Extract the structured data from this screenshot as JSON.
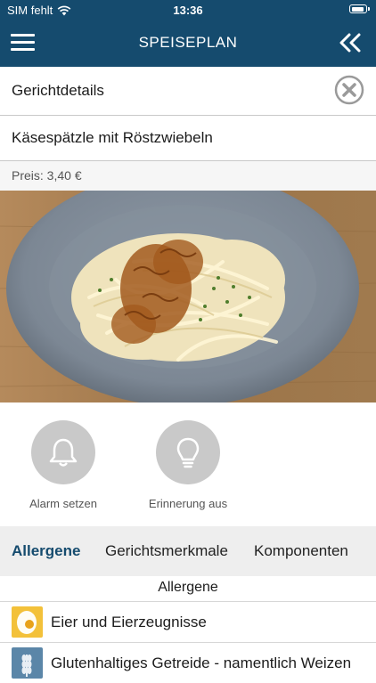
{
  "status_bar": {
    "carrier": "SIM fehlt",
    "time": "13:36"
  },
  "header": {
    "title": "SPEISEPLAN"
  },
  "details": {
    "label": "Gerichtdetails"
  },
  "dish": {
    "name": "Käsespätzle mit Röstzwiebeln",
    "price": "Preis: 3,40 €"
  },
  "actions": [
    {
      "label": "Alarm setzen",
      "icon": "bell-icon"
    },
    {
      "label": "Erinnerung aus",
      "icon": "lightbulb-icon"
    }
  ],
  "tabs": [
    {
      "label": "Allergene",
      "active": true
    },
    {
      "label": "Gerichtsmerkmale",
      "active": false
    },
    {
      "label": "Komponenten",
      "active": false
    }
  ],
  "allergens": {
    "title": "Allergene",
    "items": [
      {
        "label": "Eier und Eierzeugnisse",
        "icon": "egg-icon"
      },
      {
        "label": "Glutenhaltiges Getreide - namentlich Weizen",
        "icon": "wheat-icon"
      }
    ]
  },
  "colors": {
    "header_bg": "#154b6e",
    "active_tab": "#154b6e",
    "egg_icon_bg": "#f3c13a",
    "wheat_icon_bg": "#5b86a8"
  }
}
